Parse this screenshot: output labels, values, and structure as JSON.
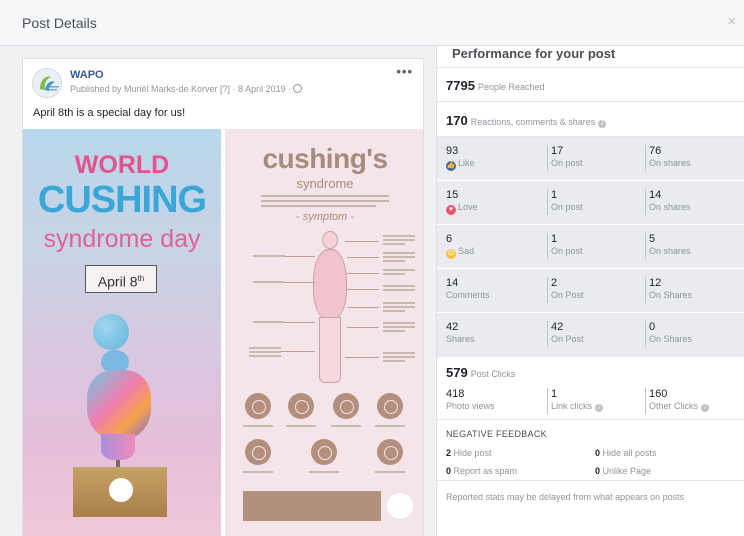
{
  "modal": {
    "title": "Post Details",
    "close": "×"
  },
  "post": {
    "page_name": "WAPO",
    "published_by": "Published by Muriël Marks-de Korver [?] · 8 April 2019 ·",
    "more": "•••",
    "message": "April 8th is a special day for us!",
    "image_left": {
      "line1": "WORLD",
      "line2": "CUSHING",
      "line3": "syndrome day",
      "date": "April 8",
      "date_sup": "th"
    },
    "image_right": {
      "title": "cushing's",
      "subtitle": "syndrome",
      "section": "- symptom -"
    }
  },
  "performance": {
    "title": "Performance for your post",
    "people_reached": {
      "value": "7795",
      "label": "People Reached"
    },
    "engagement": {
      "value": "170",
      "label": "Reactions, comments & shares"
    },
    "rows": [
      {
        "icon": "like-icon",
        "cells": [
          {
            "num": "93",
            "label": "Like"
          },
          {
            "num": "17",
            "label": "On post"
          },
          {
            "num": "76",
            "label": "On shares"
          }
        ]
      },
      {
        "icon": "love-icon",
        "cells": [
          {
            "num": "15",
            "label": "Love"
          },
          {
            "num": "1",
            "label": "On post"
          },
          {
            "num": "14",
            "label": "On shares"
          }
        ]
      },
      {
        "icon": "sad-icon",
        "cells": [
          {
            "num": "6",
            "label": "Sad"
          },
          {
            "num": "1",
            "label": "On post"
          },
          {
            "num": "5",
            "label": "On shares"
          }
        ]
      },
      {
        "cells": [
          {
            "num": "14",
            "label": "Comments"
          },
          {
            "num": "2",
            "label": "On Post"
          },
          {
            "num": "12",
            "label": "On Shares"
          }
        ]
      },
      {
        "cells": [
          {
            "num": "42",
            "label": "Shares"
          },
          {
            "num": "42",
            "label": "On Post"
          },
          {
            "num": "0",
            "label": "On Shares"
          }
        ]
      }
    ],
    "post_clicks": {
      "value": "579",
      "label": "Post Clicks",
      "cells": [
        {
          "num": "418",
          "label": "Photo views"
        },
        {
          "num": "1",
          "label": "Link clicks"
        },
        {
          "num": "160",
          "label": "Other Clicks"
        }
      ]
    },
    "negative_feedback": {
      "title": "NEGATIVE FEEDBACK",
      "hide_post": {
        "num": "2",
        "label": "Hide post"
      },
      "hide_all": {
        "num": "0",
        "label": "Hide all posts"
      },
      "spam": {
        "num": "0",
        "label": "Report as spam"
      },
      "unlike": {
        "num": "0",
        "label": "Unlike Page"
      }
    },
    "footnote": "Reported stats may be delayed from what appears on posts",
    "colors": {
      "like": "#4267b2",
      "love": "#f25268",
      "sad": "#f5c33b",
      "link": "#385898"
    }
  }
}
